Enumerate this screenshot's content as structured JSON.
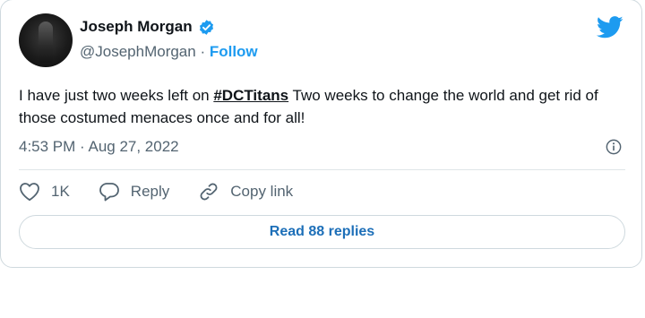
{
  "author": {
    "name": "Joseph Morgan",
    "handle": "@JosephMorgan",
    "separator": " · ",
    "follow_label": "Follow",
    "verified": true
  },
  "tweet": {
    "text_before": "I have just two weeks left on ",
    "hashtag": "#DCTitans",
    "text_after": " Two weeks to change the world and get rid of those costumed menaces once and for all!",
    "timestamp": "4:53 PM · Aug 27, 2022"
  },
  "actions": {
    "like_count": "1K",
    "reply_label": "Reply",
    "copy_link_label": "Copy link"
  },
  "read_replies_label": "Read 88 replies",
  "icons": {
    "avatar": "profile-photo",
    "verified": "verified-badge-icon",
    "brand": "twitter-bird-icon",
    "info": "info-icon",
    "like": "heart-icon",
    "reply": "speech-bubble-icon",
    "copy": "link-icon"
  },
  "colors": {
    "brand_blue": "#1d9bf0",
    "secondary_text": "#536471",
    "primary_text": "#0f1419",
    "border": "#cfd9de",
    "button_text": "#1d6fb8"
  }
}
